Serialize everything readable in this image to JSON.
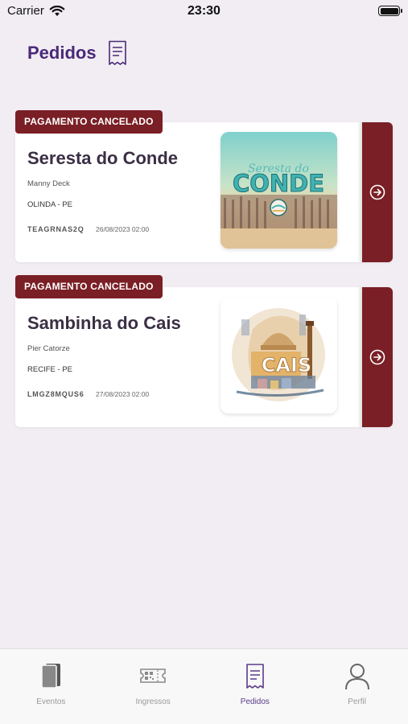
{
  "status_bar": {
    "carrier": "Carrier",
    "time": "23:30"
  },
  "header": {
    "title": "Pedidos",
    "icon": "receipt-icon"
  },
  "orders": [
    {
      "status": "PAGAMENTO CANCELADO",
      "title": "Seresta do Conde",
      "organizer": "Manny Deck",
      "location": "OLINDA - PE",
      "code": "TEAGRNAS2Q",
      "date": "26/08/2023 02:00",
      "image_text": "CONDE"
    },
    {
      "status": "PAGAMENTO CANCELADO",
      "title": "Sambinha do Cais",
      "organizer": "Pier Catorze",
      "location": "RECIFE - PE",
      "code": "LMGZ8MQUS6",
      "date": "27/08/2023 02:00",
      "image_text": "CAIS"
    }
  ],
  "tabs": [
    {
      "label": "Eventos",
      "icon": "cards-icon",
      "active": false
    },
    {
      "label": "Ingressos",
      "icon": "ticket-icon",
      "active": false
    },
    {
      "label": "Pedidos",
      "icon": "receipt-icon",
      "active": true
    },
    {
      "label": "Perfil",
      "icon": "user-icon",
      "active": false
    }
  ],
  "colors": {
    "accent": "#4a2a78",
    "cancelled": "#7a1f25",
    "background": "#f1edf3"
  }
}
